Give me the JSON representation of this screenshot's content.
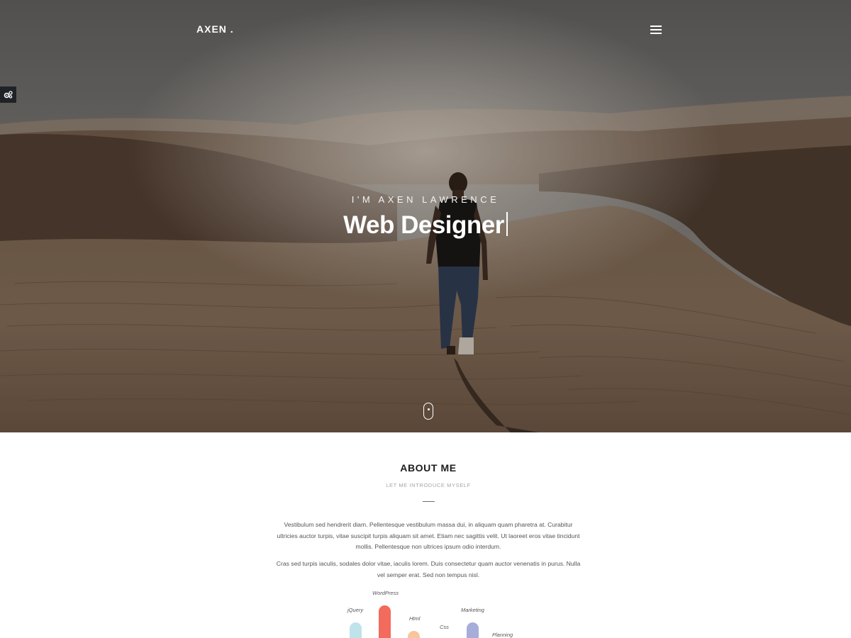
{
  "brand": {
    "logo": "AXEN ."
  },
  "hero": {
    "intro": "I'M AXEN LAWRENCE",
    "title": "Web Designer"
  },
  "icons": {
    "menu": "hamburger-icon",
    "settings": "gears-icon",
    "scroll": "mouse-scroll-icon"
  },
  "about": {
    "title": "ABOUT ME",
    "subtitle": "LET ME INTRODUCE MYSELF",
    "paragraph1": "Vestibulum sed hendrerit diam. Pellentesque vestibulum massa dui, in aliquam quam pharetra at. Curabitur ultricies auctor turpis, vitae suscipit turpis aliquam sit amet. Etiam nec sagittis velit. Ut laoreet eros vitae tincidunt mollis. Pellentesque non ultrices ipsum odio interdum.",
    "paragraph2": "Cras sed turpis iaculis, sodales dolor vitae, iaculis lorem. Duis consectetur quam auctor venenatis in purus. Nulla vel semper erat. Sed non tempus nisl."
  },
  "skills": [
    {
      "name": "jQuery",
      "color": "#bfe3ea"
    },
    {
      "name": "WordPress",
      "color": "#f26b5c"
    },
    {
      "name": "Html",
      "color": "#f8c59c"
    },
    {
      "name": "Css",
      "color": "#bfbfbf"
    },
    {
      "name": "Marketing",
      "color": "#a6add9"
    },
    {
      "name": "Planning",
      "color": "#d6e6c4"
    }
  ],
  "colors": {
    "hero_text": "#ffffff",
    "settings_bg": "#1f2226",
    "heading": "#1d1d1d"
  }
}
